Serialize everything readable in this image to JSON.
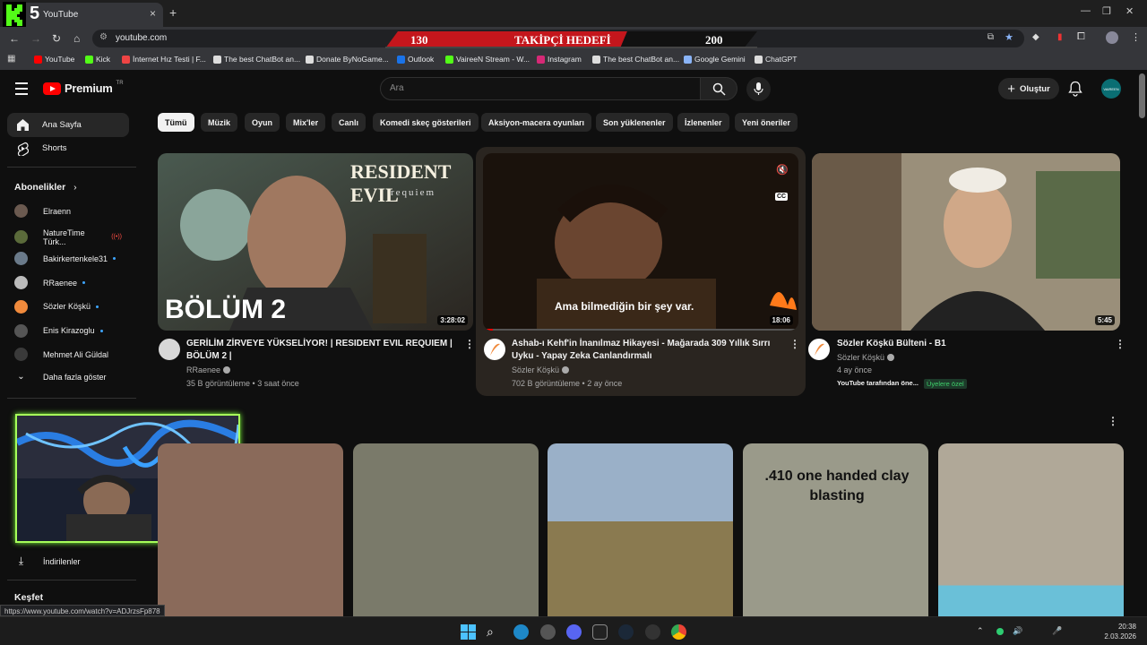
{
  "browser": {
    "tab_title": "YouTube",
    "tab_close": "×",
    "new_tab": "+",
    "url": "youtube.com",
    "logo_text": "5",
    "window_controls": [
      "—",
      "❐",
      "✕"
    ],
    "bookmarks": [
      {
        "label": "YouTube",
        "color": "#ff0000"
      },
      {
        "label": "Kick",
        "color": "#53fc18"
      },
      {
        "label": "İnternet Hız Testi | F...",
        "color": "#e44"
      },
      {
        "label": "The best ChatBot an...",
        "color": "#ddd"
      },
      {
        "label": "Donate ByNoGame...",
        "color": "#ddd"
      },
      {
        "label": "Outlook",
        "color": "#1a73e8"
      },
      {
        "label": "VaireeN Stream - W...",
        "color": "#53fc18"
      },
      {
        "label": "Instagram",
        "color": "#d62976"
      },
      {
        "label": "The best ChatBot an...",
        "color": "#ddd"
      },
      {
        "label": "Google Gemini",
        "color": "#8ab4f8"
      },
      {
        "label": "ChatGPT",
        "color": "#ddd"
      }
    ]
  },
  "goal_banner": {
    "current": "130",
    "label": "TAKİPÇİ HEDEFİ",
    "target": "200"
  },
  "header": {
    "logo": "Premium",
    "region": "TR",
    "search_placeholder": "Ara",
    "create_label": "Oluştur",
    "avatar_text": "VAIREEN"
  },
  "sidebar": {
    "items": [
      {
        "label": "Ana Sayfa"
      },
      {
        "label": "Shorts"
      }
    ],
    "subscriptions_title": "Abonelikler",
    "subscriptions": [
      {
        "label": "Elraenn",
        "color": "#6b5a50",
        "badge": ""
      },
      {
        "label": "NatureTime Türk...",
        "color": "#5a6a3a",
        "badge": "live"
      },
      {
        "label": "Bakirkertenkele31",
        "color": "#6a7a8a",
        "badge": "dot"
      },
      {
        "label": "RRaenee",
        "color": "#bbbbbb",
        "badge": "dot"
      },
      {
        "label": "Sözler Köşkü",
        "color": "#f08a3c",
        "badge": "dot"
      },
      {
        "label": "Enis Kirazoglu",
        "color": "#555555",
        "badge": "dot"
      },
      {
        "label": "Mehmet Ali Güldal",
        "color": "#3a3a3a",
        "badge": ""
      }
    ],
    "show_more": "Daha fazla göster",
    "downloads": "İndirilenler",
    "explore": "Keşfet"
  },
  "chips": [
    "Tümü",
    "Müzik",
    "Oyun",
    "Mix'ler",
    "Canlı",
    "Komedi skeç gösterileri",
    "Aksiyon-macera oyunları",
    "Son yüklenenler",
    "İzlenenler",
    "Yeni öneriler"
  ],
  "videos": [
    {
      "title_line1": "GERİLİM ZİRVEYE YÜKSELİYOR! | RESIDENT EVIL REQUIEM |",
      "title_line2": "BÖLÜM 2 |",
      "channel": "RRaenee",
      "meta": "35 B görüntüleme • 3 saat önce",
      "duration": "3:28:02",
      "thumb_title": "RESIDENT EVIL",
      "thumb_subtitle": "requiem",
      "thumb_episode": "BÖLÜM 2",
      "color": "#6b5f52"
    },
    {
      "title_line1": "Ashab-ı Kehf'in İnanılmaz Hikayesi - Mağarada 309 Yıllık Sırrı",
      "title_line2": "Uyku - Yapay Zeka Canlandırmalı",
      "channel": "Sözler Köşkü",
      "meta": "702 B görüntüleme • 2 ay önce",
      "duration": "18:06",
      "caption": "Ama bilmediğin bir şey var.",
      "cc": "CC",
      "color": "#3a2a1c"
    },
    {
      "title_line1": "Sözler Köşkü Bülteni - B1",
      "title_line2": "",
      "channel": "Sözler Köşkü",
      "meta": "4 ay önce",
      "badge1": "YouTube tarafından öne...",
      "badge2": "Üyelere özel",
      "duration": "5:45",
      "color": "#8a8070"
    }
  ],
  "shorts": [
    {
      "color": "#8a6a5a"
    },
    {
      "color": "#7a7a6a"
    },
    {
      "color": "#8fa0b0"
    },
    {
      "color": "#9a9a8a",
      "text": ".410 one handed clay blasting"
    },
    {
      "color": "#b0a898"
    }
  ],
  "status_url": "https://www.youtube.com/watch?v=ADJrzsFp878",
  "clock": {
    "time": "20:38",
    "date": "2.03.2026"
  },
  "tray": [
    "⌃",
    "🔊",
    "🎤"
  ]
}
